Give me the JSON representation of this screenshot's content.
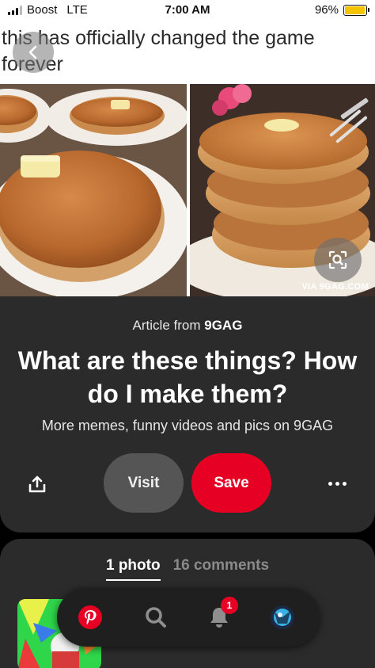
{
  "status_bar": {
    "carrier": "Boost",
    "network": "LTE",
    "time": "7:00 AM",
    "battery": "96%",
    "battery_level": 0.96,
    "battery_color": "#f5c400"
  },
  "pin_image": {
    "caption": "this has officially changed the game forever",
    "watermark": "VIA 9GAG.COM",
    "back_icon": "chevron-left-icon",
    "lens_icon": "visual-search-icon"
  },
  "article": {
    "prefix": "Article from",
    "source": "9GAG",
    "title": "What are these things? How do I make them?",
    "description": "More memes, funny videos and pics on 9GAG"
  },
  "actions": {
    "share_icon": "share-icon",
    "visit_label": "Visit",
    "save_label": "Save",
    "more_icon": "more-dots-icon",
    "save_color": "#e60023"
  },
  "comments_section": {
    "tabs": [
      {
        "label": "1 photo",
        "active": true
      },
      {
        "label": "16 comments",
        "active": false
      }
    ]
  },
  "bottom_nav": {
    "items": [
      {
        "icon": "pinterest-logo-icon"
      },
      {
        "icon": "search-icon"
      },
      {
        "icon": "bell-icon",
        "badge": "1"
      },
      {
        "icon": "avatar-icon"
      }
    ]
  }
}
